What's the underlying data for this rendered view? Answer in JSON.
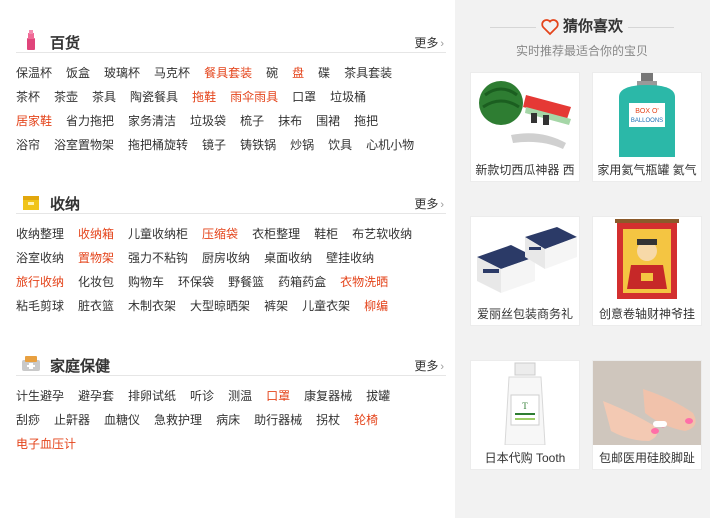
{
  "sections": [
    {
      "title": "百货",
      "more": "更多",
      "rows": [
        [
          {
            "t": "保温杯"
          },
          {
            "t": "饭盒"
          },
          {
            "t": "玻璃杯"
          },
          {
            "t": "马克杯"
          },
          {
            "t": "餐具套装",
            "hot": true
          },
          {
            "t": "碗"
          },
          {
            "t": "盘",
            "hot": true
          },
          {
            "t": "碟"
          },
          {
            "t": "茶具套装"
          }
        ],
        [
          {
            "t": "茶杯"
          },
          {
            "t": "茶壶"
          },
          {
            "t": "茶具"
          },
          {
            "t": "陶瓷餐具"
          },
          {
            "t": "拖鞋",
            "hot": true
          },
          {
            "t": "雨伞雨具",
            "hot": true
          },
          {
            "t": "口罩"
          },
          {
            "t": "垃圾桶"
          }
        ],
        [
          {
            "t": "居家鞋",
            "hot": true
          },
          {
            "t": "省力拖把"
          },
          {
            "t": "家务清洁"
          },
          {
            "t": "垃圾袋"
          },
          {
            "t": "梳子"
          },
          {
            "t": "抹布"
          },
          {
            "t": "围裙"
          },
          {
            "t": "拖把"
          }
        ],
        [
          {
            "t": "浴帘"
          },
          {
            "t": "浴室置物架"
          },
          {
            "t": "拖把桶旋转"
          },
          {
            "t": "镜子"
          },
          {
            "t": "铸铁锅"
          },
          {
            "t": "炒锅"
          },
          {
            "t": "饮具"
          },
          {
            "t": "心机小物"
          }
        ]
      ]
    },
    {
      "title": "收纳",
      "more": "更多",
      "rows": [
        [
          {
            "t": "收纳整理"
          },
          {
            "t": "收纳箱",
            "hot": true
          },
          {
            "t": "儿童收纳柜"
          },
          {
            "t": "压缩袋",
            "hot": true
          },
          {
            "t": "衣柜整理"
          },
          {
            "t": "鞋柜"
          },
          {
            "t": "布艺软收纳"
          }
        ],
        [
          {
            "t": "浴室收纳"
          },
          {
            "t": "置物架",
            "hot": true
          },
          {
            "t": "强力不粘钩"
          },
          {
            "t": "厨房收纳"
          },
          {
            "t": "桌面收纳"
          },
          {
            "t": "壁挂收纳"
          }
        ],
        [
          {
            "t": "旅行收纳",
            "hot": true
          },
          {
            "t": "化妆包"
          },
          {
            "t": "购物车"
          },
          {
            "t": "环保袋"
          },
          {
            "t": "野餐篮"
          },
          {
            "t": "药箱药盒"
          },
          {
            "t": "衣物洗晒",
            "hot": true
          }
        ],
        [
          {
            "t": "粘毛剪球"
          },
          {
            "t": "脏衣篮"
          },
          {
            "t": "木制衣架"
          },
          {
            "t": "大型晾晒架"
          },
          {
            "t": "裤架"
          },
          {
            "t": "儿童衣架"
          },
          {
            "t": "柳编",
            "hot": true
          }
        ]
      ]
    },
    {
      "title": "家庭保健",
      "more": "更多",
      "rows": [
        [
          {
            "t": "计生避孕"
          },
          {
            "t": "避孕套"
          },
          {
            "t": "排卵试纸"
          },
          {
            "t": "听诊"
          },
          {
            "t": "测温"
          },
          {
            "t": "口罩",
            "hot": true
          },
          {
            "t": "康复器械"
          },
          {
            "t": "拔罐"
          }
        ],
        [
          {
            "t": "刮痧"
          },
          {
            "t": "止鼾器"
          },
          {
            "t": "血糖仪"
          },
          {
            "t": "急救护理"
          },
          {
            "t": "病床"
          },
          {
            "t": "助行器械"
          },
          {
            "t": "拐杖"
          },
          {
            "t": "轮椅",
            "hot": true
          }
        ],
        [
          {
            "t": "电子血压计",
            "hot": true
          }
        ]
      ]
    }
  ],
  "guess": {
    "title": "猜你喜欢",
    "subtitle": "实时推荐最适合你的宝贝",
    "items": [
      {
        "caption": "新款切西瓜神器 西",
        "image": "watermelon-cutter"
      },
      {
        "caption": "家用氦气瓶罐 氦气",
        "image": "helium-tank"
      },
      {
        "caption": "爱丽丝包装商务礼",
        "image": "gift-boxes"
      },
      {
        "caption": "创意卷轴财神爷挂",
        "image": "god-of-wealth-scroll"
      },
      {
        "caption": "日本代购 Tooth",
        "image": "toothpaste-bottle"
      },
      {
        "caption": "包邮医用硅胶脚趾",
        "image": "toe-separator"
      }
    ],
    "colors": {
      "accent": "#e4441b",
      "heart": "#e4441b"
    }
  },
  "icons": [
    "lipstick-icon",
    "storage-box-icon",
    "health-icon",
    "heart-icon",
    "chevron-right-icon"
  ]
}
